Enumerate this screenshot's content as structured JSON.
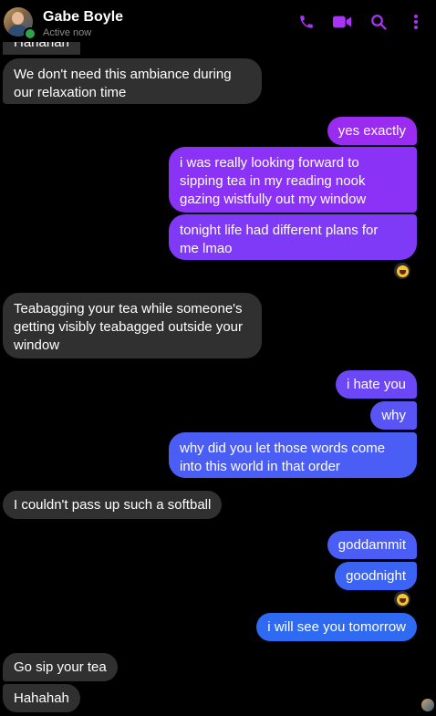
{
  "header": {
    "contact_name": "Gabe Boyle",
    "status": "Active now",
    "icons": [
      "phone-icon",
      "video-camera-icon",
      "search-icon",
      "more-options-icon"
    ],
    "accent_color": "#a933f6"
  },
  "messages": [
    {
      "sender": "them",
      "lines": [
        "Hahahah"
      ]
    },
    {
      "sender": "them",
      "lines": [
        "We don't need this ambiance during",
        "our relaxation time"
      ]
    },
    {
      "sender": "me",
      "lines": [
        "yes exactly"
      ]
    },
    {
      "sender": "me",
      "lines": [
        "i was really looking forward to",
        "sipping tea in my reading nook",
        "gazing wistfully out my window"
      ]
    },
    {
      "sender": "me",
      "lines": [
        "tonight life had different plans for",
        "me lmao"
      ],
      "reaction": "laughing-emoji"
    },
    {
      "sender": "them",
      "lines": [
        "Teabagging your tea while someone's",
        "getting visibly teabagged outside your",
        "window"
      ]
    },
    {
      "sender": "me",
      "lines": [
        "i hate you"
      ]
    },
    {
      "sender": "me",
      "lines": [
        "why"
      ]
    },
    {
      "sender": "me",
      "lines": [
        "why did you let those words come",
        "into this world in that order"
      ]
    },
    {
      "sender": "them",
      "lines": [
        "I couldn't pass up such a softball"
      ]
    },
    {
      "sender": "me",
      "lines": [
        "goddammit"
      ]
    },
    {
      "sender": "me",
      "lines": [
        "goodnight"
      ],
      "reaction": "laughing-emoji"
    },
    {
      "sender": "me",
      "lines": [
        "i will see you tomorrow"
      ]
    },
    {
      "sender": "them",
      "lines": [
        "Go sip your tea"
      ]
    },
    {
      "sender": "them",
      "lines": [
        "Hahahah"
      ]
    }
  ]
}
